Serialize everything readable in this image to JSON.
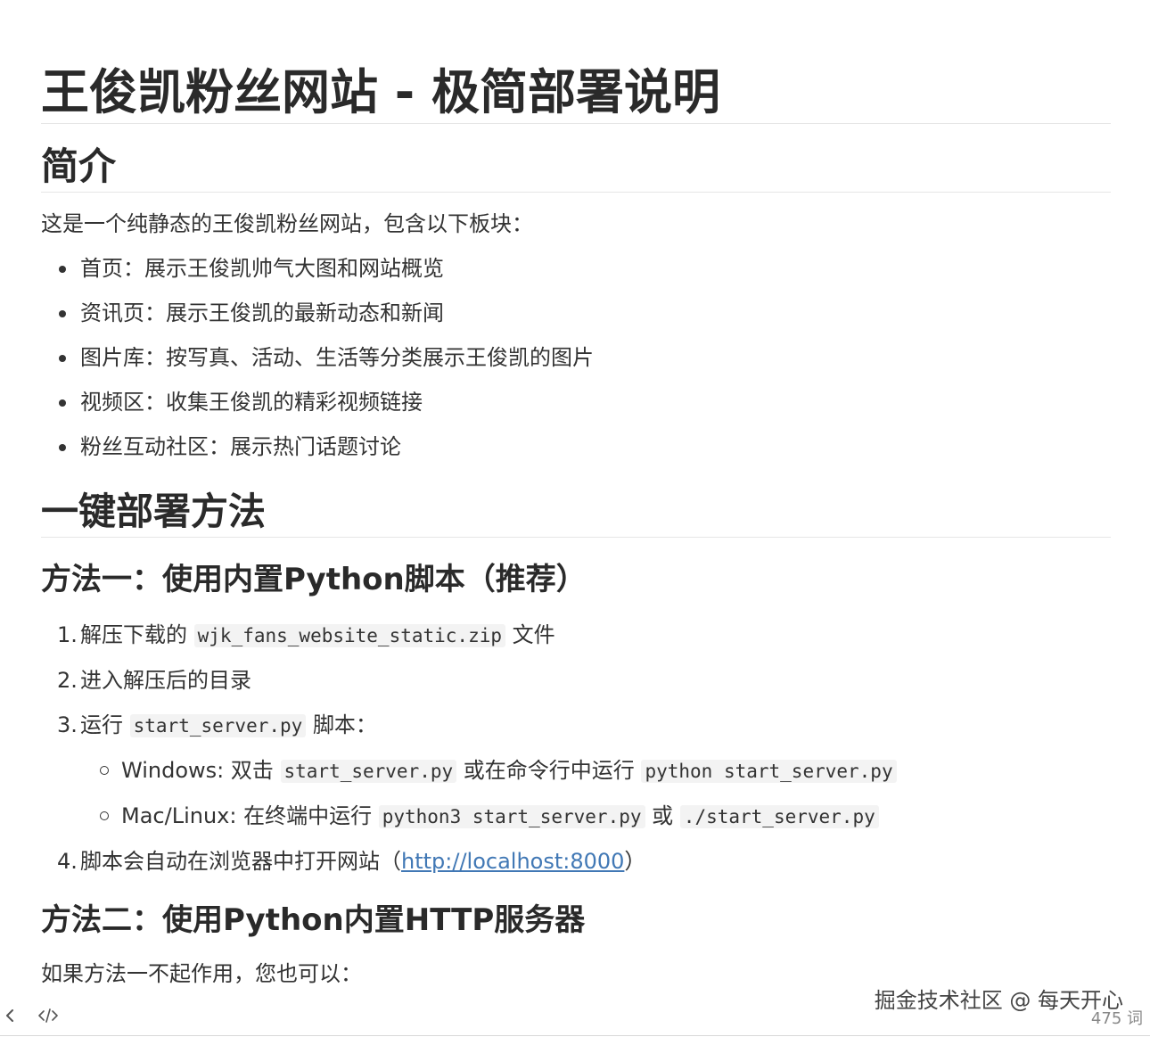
{
  "document": {
    "title": "王俊凯粉丝网站 - 极简部署说明",
    "intro_heading": "简介",
    "intro_text": "这是一个纯静态的王俊凯粉丝网站，包含以下板块：",
    "sections": [
      "首页：展示王俊凯帅气大图和网站概览",
      "资讯页：展示王俊凯的最新动态和新闻",
      "图片库：按写真、活动、生活等分类展示王俊凯的图片",
      "视频区：收集王俊凯的精彩视频链接",
      "粉丝互动社区：展示热门话题讨论"
    ],
    "deploy_heading": "一键部署方法",
    "method1": {
      "heading": "方法一：使用内置Python脚本（推荐）",
      "step1_num": "1.",
      "step1_prefix": "解压下载的",
      "step1_code": "wjk_fans_website_static.zip",
      "step1_suffix": "文件",
      "step2_num": "2.",
      "step2_text": "进入解压后的目录",
      "step3_num": "3.",
      "step3_prefix": "运行",
      "step3_code": "start_server.py",
      "step3_suffix": "脚本：",
      "windows_label": "Windows: 双击",
      "windows_code1": "start_server.py",
      "windows_middle": "或在命令行中运行",
      "windows_code2": "python start_server.py",
      "mac_label": "Mac/Linux: 在终端中运行",
      "mac_code1": "python3 start_server.py",
      "mac_middle": "或",
      "mac_code2": "./start_server.py",
      "step4_num": "4.",
      "step4_prefix": "脚本会自动在浏览器中打开网站（",
      "step4_link": "http://localhost:8000",
      "step4_suffix": "）"
    },
    "method2": {
      "heading": "方法二：使用Python内置HTTP服务器",
      "text": "如果方法一不起作用，您也可以："
    }
  },
  "watermark": "掘金技术社区 @ 每天开心",
  "status_bar": {
    "word_count": "475 词"
  },
  "icons": {
    "back": "chevron-left-icon",
    "source": "code-icon"
  },
  "colors": {
    "link": "#4178b5",
    "code_bg": "#f3f3f3",
    "heading": "#2a2a2a"
  }
}
